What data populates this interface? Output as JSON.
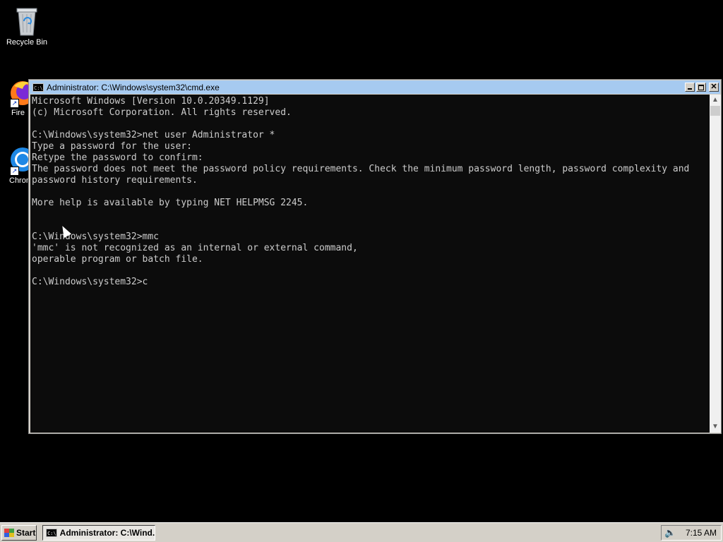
{
  "desktop": {
    "icons": [
      {
        "label": "Recycle Bin",
        "icon": "recycle-bin-icon"
      },
      {
        "label": "Fire",
        "icon": "firefox-icon"
      },
      {
        "label": "Chron",
        "icon": "chrome-icon"
      }
    ]
  },
  "window": {
    "title": "Administrator: C:\\Windows\\system32\\cmd.exe",
    "icon_text": "C:\\",
    "close_glyph": "✕",
    "console_text": "Microsoft Windows [Version 10.0.20349.1129]\n(c) Microsoft Corporation. All rights reserved.\n\nC:\\Windows\\system32>net user Administrator *\nType a password for the user:\nRetype the password to confirm:\nThe password does not meet the password policy requirements. Check the minimum password length, password complexity and\npassword history requirements.\n\nMore help is available by typing NET HELPMSG 2245.\n\n\nC:\\Windows\\system32>mmc\n'mmc' is not recognized as an internal or external command,\noperable program or batch file.\n\nC:\\Windows\\system32>c",
    "scroll_up_glyph": "▲",
    "scroll_down_glyph": "▼"
  },
  "taskbar": {
    "start_label": "Start",
    "task_label": "Administrator: C:\\Wind...",
    "speaker_glyph": "🔈",
    "clock": "7:15 AM"
  },
  "colors": {
    "desktop": "#000000",
    "titlebar": "#a6caf0",
    "console_bg": "#0c0c0c",
    "console_fg": "#cccccc",
    "taskbar": "#d4d0c8"
  }
}
